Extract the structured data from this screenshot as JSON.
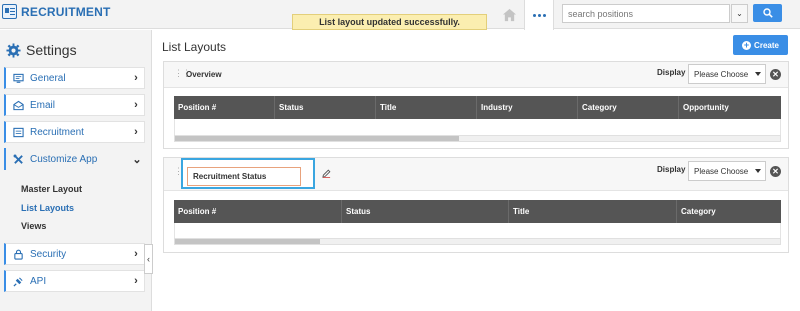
{
  "header": {
    "app_title": "RECRUITMENT",
    "toast": "List layout updated successfully.",
    "search_placeholder": "search positions",
    "icons": [
      "recruitment-app-icon",
      "home-icon",
      "more-dots-icon",
      "chevron-down-icon",
      "search-icon"
    ]
  },
  "sidebar": {
    "title": "Settings",
    "items": [
      {
        "label": "General",
        "icon": "monitor-icon",
        "chevron": "›"
      },
      {
        "label": "Email",
        "icon": "envelope-icon",
        "chevron": "›"
      },
      {
        "label": "Recruitment",
        "icon": "list-icon",
        "chevron": "›"
      },
      {
        "label": "Customize App",
        "icon": "wrench-icon",
        "chevron": "⌄"
      },
      {
        "label": "Security",
        "icon": "lock-icon",
        "chevron": "›"
      },
      {
        "label": "API",
        "icon": "plug-icon",
        "chevron": "›"
      }
    ],
    "sub_items": [
      "Master Layout",
      "List Layouts",
      "Views"
    ],
    "active_sub_item": "List Layouts",
    "collapse": "‹"
  },
  "main": {
    "title": "List Layouts",
    "create_label": "Create",
    "panels": [
      {
        "name": "Overview",
        "display_label": "Display",
        "display_value": "Please Choose",
        "columns": [
          "Position #",
          "Status",
          "Title",
          "Industry",
          "Category",
          "Opportunity"
        ],
        "scroll_fraction": 0.47
      },
      {
        "name": "Recruitment Status",
        "display_label": "Display",
        "display_value": "Please Choose",
        "columns": [
          "Position #",
          "Status",
          "Title",
          "Category"
        ],
        "scroll_fraction": 0.24
      }
    ]
  },
  "colors": {
    "accent": "#3a8ee6",
    "brand": "#2a6fb4",
    "toast_bg": "#fbeeb0",
    "table_header": "#555555",
    "edit_highlight": "#3aa6e0"
  }
}
